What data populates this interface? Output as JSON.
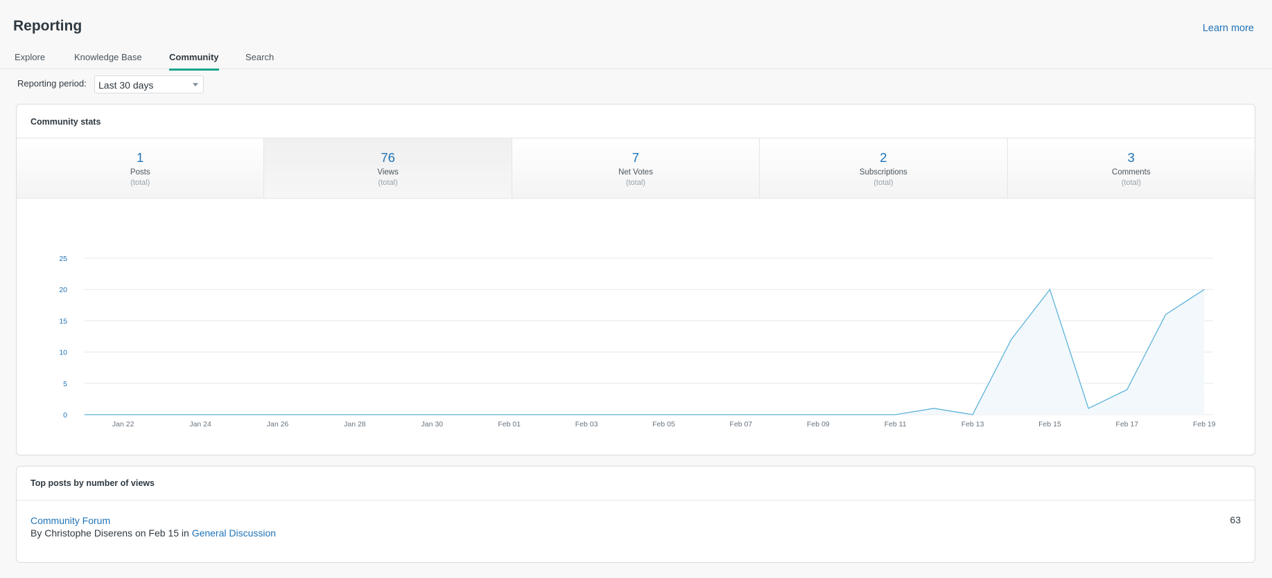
{
  "header": {
    "title": "Reporting",
    "learn_more": "Learn more"
  },
  "tabs": [
    {
      "label": "Explore"
    },
    {
      "label": "Knowledge Base"
    },
    {
      "label": "Community",
      "active": true
    },
    {
      "label": "Search"
    }
  ],
  "period": {
    "label": "Reporting period:",
    "value": "Last 30 days"
  },
  "stats_card": {
    "title": "Community stats",
    "stats": [
      {
        "value": "1",
        "label": "Posts",
        "sub": "(total)"
      },
      {
        "value": "76",
        "label": "Views",
        "sub": "(total)",
        "selected": true
      },
      {
        "value": "7",
        "label": "Net Votes",
        "sub": "(total)"
      },
      {
        "value": "2",
        "label": "Subscriptions",
        "sub": "(total)"
      },
      {
        "value": "3",
        "label": "Comments",
        "sub": "(total)"
      }
    ]
  },
  "chart_data": {
    "type": "area",
    "x_tick_labels": [
      "Jan 22",
      "Jan 24",
      "Jan 26",
      "Jan 28",
      "Jan 30",
      "Feb 01",
      "Feb 03",
      "Feb 05",
      "Feb 07",
      "Feb 09",
      "Feb 11",
      "Feb 13",
      "Feb 15",
      "Feb 17",
      "Feb 19"
    ],
    "x": [
      "Jan 21",
      "Jan 22",
      "Jan 23",
      "Jan 24",
      "Jan 25",
      "Jan 26",
      "Jan 27",
      "Jan 28",
      "Jan 29",
      "Jan 30",
      "Jan 31",
      "Feb 01",
      "Feb 02",
      "Feb 03",
      "Feb 04",
      "Feb 05",
      "Feb 06",
      "Feb 07",
      "Feb 08",
      "Feb 09",
      "Feb 10",
      "Feb 11",
      "Feb 12",
      "Feb 13",
      "Feb 14",
      "Feb 15",
      "Feb 16",
      "Feb 17",
      "Feb 18",
      "Feb 19"
    ],
    "series": [
      {
        "values": [
          0,
          0,
          0,
          0,
          0,
          0,
          0,
          0,
          0,
          0,
          0,
          0,
          0,
          0,
          0,
          0,
          0,
          0,
          0,
          0,
          0,
          0,
          1,
          0,
          12,
          20,
          1,
          4,
          16,
          20
        ]
      }
    ],
    "y_ticks": [
      0,
      5,
      10,
      15,
      20,
      25
    ],
    "ylim": [
      0,
      25
    ],
    "grid": true,
    "line_color": "#5bb3d9",
    "fill_color": "#f3f8fc",
    "axis_label_color": "#1f73b7"
  },
  "top_posts": {
    "title": "Top posts by number of views",
    "items": [
      {
        "title": "Community Forum",
        "by": "By Christophe Diserens on Feb 15 in",
        "category": "General Discussion",
        "count": "63"
      }
    ]
  }
}
